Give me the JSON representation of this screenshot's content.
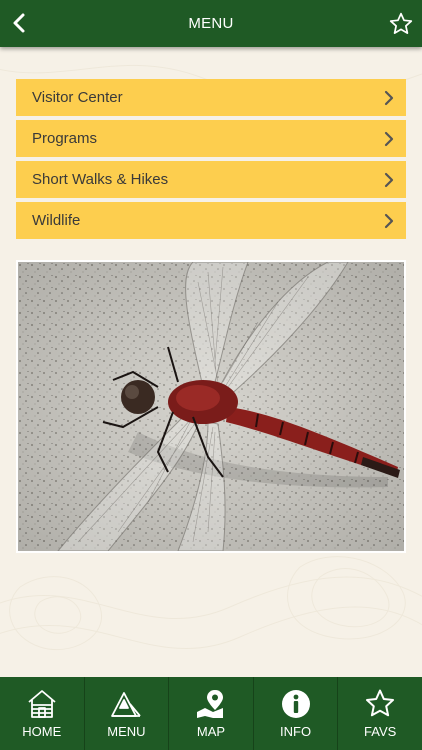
{
  "header": {
    "title": "MENU",
    "back_icon": "chevron-left-icon",
    "favorite_icon": "star-outline-icon"
  },
  "menu": {
    "items": [
      {
        "label": "Visitor Center"
      },
      {
        "label": "Programs"
      },
      {
        "label": "Short Walks & Hikes"
      },
      {
        "label": "Wildlife"
      }
    ]
  },
  "photo": {
    "subject": "red dragonfly on speckled stone"
  },
  "tabbar": {
    "tabs": [
      {
        "label": "HOME",
        "icon": "cabin-icon"
      },
      {
        "label": "MENU",
        "icon": "mountains-icon"
      },
      {
        "label": "MAP",
        "icon": "map-pin-icon"
      },
      {
        "label": "INFO",
        "icon": "info-icon"
      },
      {
        "label": "FAVS",
        "icon": "star-icon"
      }
    ]
  },
  "colors": {
    "header_green": "#1f5a25",
    "menu_yellow": "#fdce4e",
    "background": "#f6f1e7"
  }
}
